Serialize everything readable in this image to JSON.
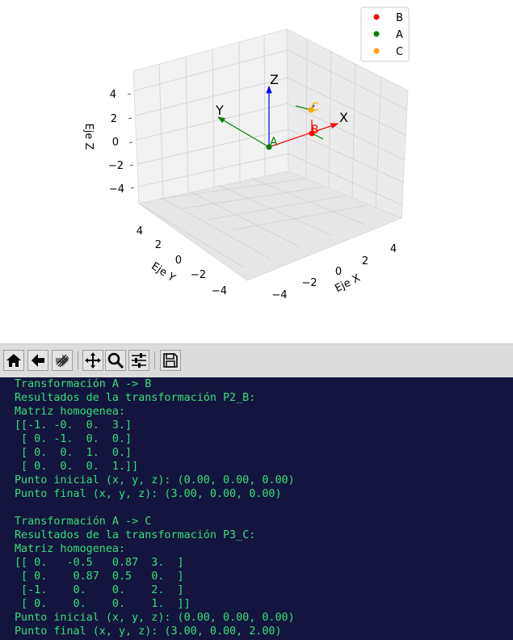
{
  "plot": {
    "axes": {
      "x_label": "Eje X",
      "y_label": "Eje Y",
      "z_label": "Eje Z"
    },
    "ticks": {
      "z": [
        "4",
        "2",
        "0",
        "−2",
        "−4"
      ],
      "y": [
        "4",
        "2",
        "0",
        "−2",
        "−4"
      ],
      "x": [
        "−4",
        "−2",
        "0",
        "2",
        "4"
      ]
    },
    "frame_labels": {
      "x": "X",
      "y": "Y",
      "z": "Z"
    },
    "point_labels": {
      "a": "A",
      "b": "B",
      "c": "C"
    },
    "legend": [
      {
        "label": "B",
        "color": "#ff0000"
      },
      {
        "label": "A",
        "color": "#008000"
      },
      {
        "label": "C",
        "color": "#ffa500"
      }
    ]
  },
  "toolbar": {
    "buttons": [
      "home-icon",
      "back-icon",
      "forward-icon",
      "pan-icon",
      "zoom-icon",
      "configure-subplots-icon",
      "save-icon"
    ]
  },
  "terminal": {
    "lines": [
      "Transformación A -> B",
      "Resultados de la transformación P2_B:",
      "Matriz homogenea:",
      "[[-1. -0.  0.  3.]",
      " [ 0. -1.  0.  0.]",
      " [ 0.  0.  1.  0.]",
      " [ 0.  0.  0.  1.]]",
      "Punto inicial (x, y, z): (0.00, 0.00, 0.00)",
      "Punto final (x, y, z): (3.00, 0.00, 0.00)",
      "",
      "Transformación A -> C",
      "Resultados de la transformación P3_C:",
      "Matriz homogenea:",
      "[[ 0.   -0.5   0.87  3.  ]",
      " [ 0.    0.87  0.5   0.  ]",
      " [-1.    0.    0.    2.  ]",
      " [ 0.    0.    0.    1.  ]]",
      "Punto inicial (x, y, z): (0.00, 0.00, 0.00)",
      "Punto final (x, y, z): (3.00, 0.00, 2.00)"
    ]
  }
}
